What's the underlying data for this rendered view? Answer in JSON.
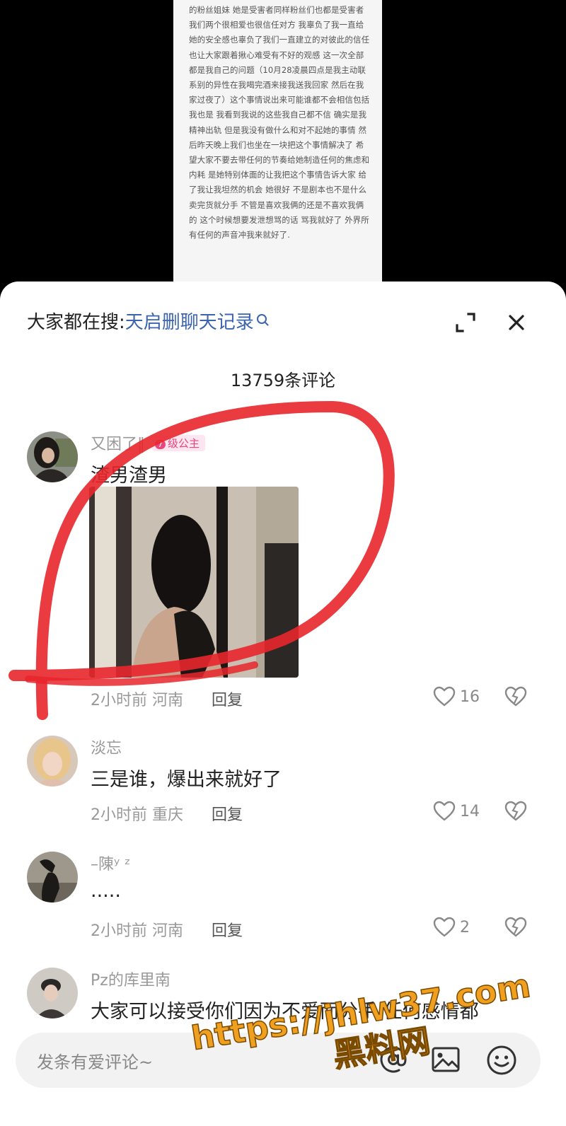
{
  "statement": {
    "text": "的粉丝姐妹 她是受害者同样粉丝们也都是受害者 我们两个很相爱也很信任对方 我辜负了我一直给她的安全感也辜负了我们一直建立的对彼此的信任 也让大家跟着揪心难受有不好的观感 这一次全部都是我自己的问题（10月28凌晨四点是我主动联系别的异性在我喝完酒来接我送我回家 然后在我家过夜了）这个事情说出来可能谁都不会相信包括我也是 我看到我说的这些我自己都不信 确实是我精神出轨 但是我没有做什么和对不起她的事情 然后昨天晚上我们也坐在一块把这个事情解决了 希望大家不要去带任何的节奏给她制造任何的焦虑和内耗 是她特别体面的让我把这个事情告诉大家 给了我让我坦然的机会 她很好 不是剧本也不是什么卖完货就分手 不管是喜欢我俩的还是不喜欢我俩的 这个时候想要发泄想骂的话 骂我就好了 外界所有任何的声音冲我来就好了."
  },
  "header": {
    "search_prefix": "大家都在搜:",
    "search_term": "天启删聊天记录"
  },
  "comment_count": "13759条评论",
  "comments": [
    {
      "username": "又困了‖",
      "badge_level": "7",
      "badge_text": "级公主",
      "text": "渣男渣男",
      "time": "2小时前",
      "location": "河南",
      "reply": "回复",
      "likes": "16"
    },
    {
      "username": "淡忘",
      "text": "三是谁，爆出来就好了",
      "time": "2小时前",
      "location": "重庆",
      "reply": "回复",
      "likes": "14"
    },
    {
      "username": "–陳ʸ ᶻ",
      "text": ".....",
      "time": "2小时前",
      "location": "河南",
      "reply": "回复",
      "likes": "2"
    },
    {
      "username": "Pz的库里南",
      "text": "大家可以接受你们因为不爱而分手 任何感情都"
    }
  ],
  "input": {
    "placeholder": "发条有爱评论~"
  },
  "watermark": {
    "line1": "https://jhlw37.com",
    "line2": "黑料网"
  },
  "colors": {
    "link_blue": "#3a64b0",
    "badge_pink": "#e8467c",
    "annotation_red": "#e8262c",
    "watermark_orange": "#f0a020"
  }
}
